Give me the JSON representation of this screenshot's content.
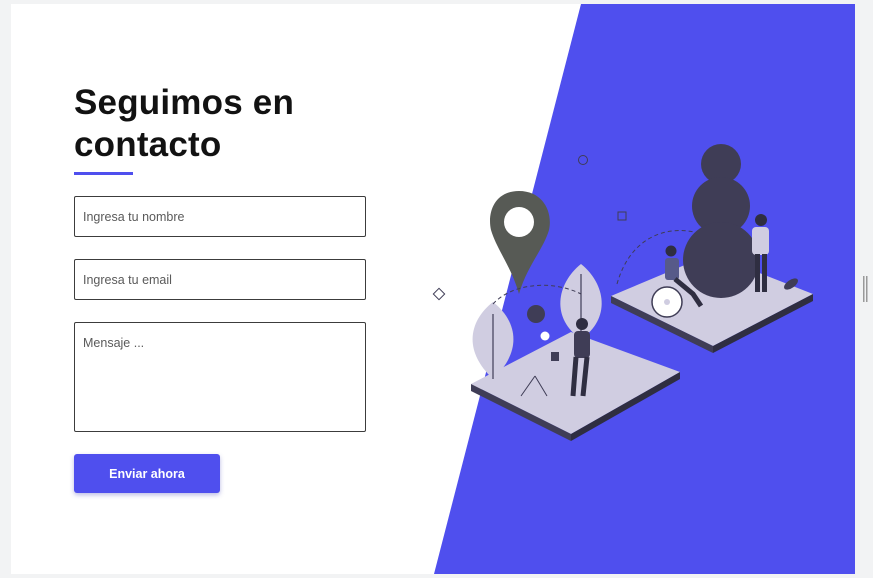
{
  "contact": {
    "title_line1": "Seguimos en",
    "title_line2": "contacto",
    "name_placeholder": "Ingresa tu nombre",
    "email_placeholder": "Ingresa tu email",
    "message_placeholder": "Mensaje ...",
    "submit_label": "Enviar ahora"
  },
  "colors": {
    "accent": "#4f4fee",
    "panel": "#4f4fee",
    "text": "#121212",
    "illustration_dark": "#3f3d56",
    "illustration_light": "#d0cde1"
  },
  "icons": [
    "location-pin-icon",
    "scroll-handle-icon"
  ]
}
